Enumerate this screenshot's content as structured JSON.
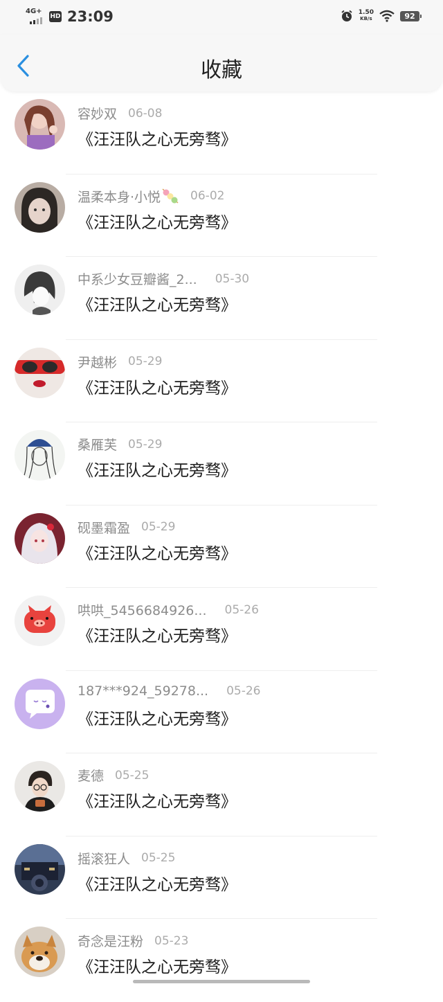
{
  "status_bar": {
    "network": "4G+",
    "hd": "HD",
    "time": "23:09",
    "speed_value": "1.50",
    "speed_unit": "KB/s",
    "battery": "92"
  },
  "header": {
    "title": "收藏",
    "back_icon": "chevron-left-icon"
  },
  "favorites": [
    {
      "name": "容妙双",
      "date": "06-08",
      "book": "《汪汪队之心无旁骛》"
    },
    {
      "name": "温柔本身·小悦",
      "date": "06-02",
      "book": "《汪汪队之心无旁骛》"
    },
    {
      "name": "中系少女豆瓣酱_2...",
      "date": "05-30",
      "book": "《汪汪队之心无旁骛》"
    },
    {
      "name": "尹越彬",
      "date": "05-29",
      "book": "《汪汪队之心无旁骛》"
    },
    {
      "name": "桑雁芙",
      "date": "05-29",
      "book": "《汪汪队之心无旁骛》"
    },
    {
      "name": "砚墨霜盈",
      "date": "05-29",
      "book": "《汪汪队之心无旁骛》"
    },
    {
      "name": "哄哄_5456684926...",
      "date": "05-26",
      "book": "《汪汪队之心无旁骛》"
    },
    {
      "name": "187***924_59278...",
      "date": "05-26",
      "book": "《汪汪队之心无旁骛》"
    },
    {
      "name": "麦德",
      "date": "05-25",
      "book": "《汪汪队之心无旁骛》"
    },
    {
      "name": "摇滚狂人",
      "date": "05-25",
      "book": "《汪汪队之心无旁骛》"
    },
    {
      "name": "奇念是汪粉",
      "date": "05-23",
      "book": "《汪汪队之心无旁骛》"
    }
  ],
  "colors": {
    "accent": "#2a8fe0",
    "name_text": "#8c8c8c",
    "date_text": "#ababab",
    "book_text": "#1e1e1e"
  }
}
